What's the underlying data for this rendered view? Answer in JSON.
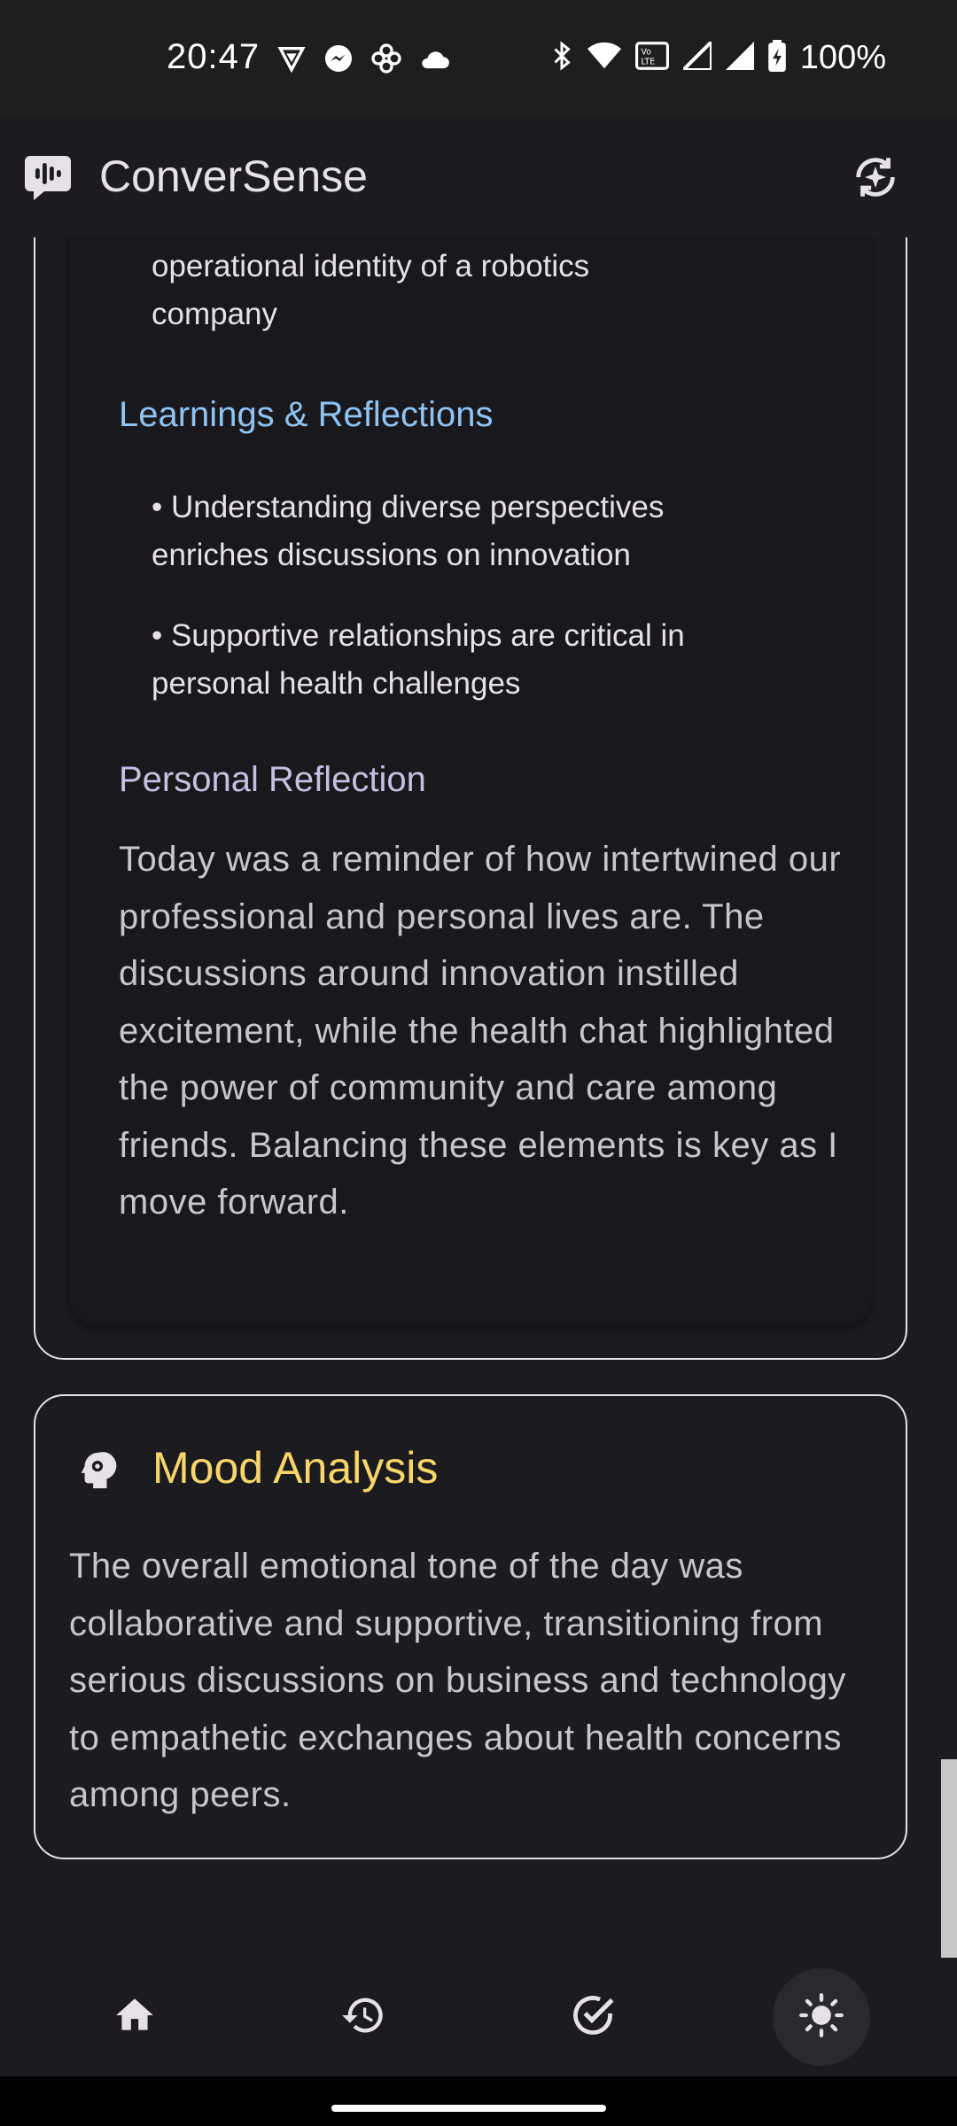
{
  "status_bar": {
    "time": "20:47",
    "left_icons": [
      "vpn-shield-icon",
      "messenger-icon",
      "pinwheel-icon",
      "cloud-icon"
    ],
    "right_icons": [
      "bluetooth-icon",
      "wifi-icon",
      "volte-icon",
      "signal-icon",
      "signal-icon",
      "battery-charging-icon"
    ],
    "battery": "100%"
  },
  "app_bar": {
    "title": "ConverSense",
    "logo_icon": "waveform-chat-icon",
    "action_icon": "ai-sparkle-sync-icon"
  },
  "summary_card": {
    "partial_bullet_lines": [
      "operational identity of a robotics",
      "company"
    ],
    "learnings_heading": "Learnings & Reflections",
    "learnings": [
      {
        "line1": "• Understanding diverse perspectives",
        "line2": "enriches discussions on innovation"
      },
      {
        "line1": "• Supportive relationships are critical in",
        "line2": "personal health challenges"
      }
    ],
    "reflection_heading": "Personal Reflection",
    "reflection_text": "Today was a reminder of how intertwined our professional and personal lives are. The discussions around innovation instilled excitement, while the health chat highlighted the power of community and care among friends. Balancing these elements is key as I move forward."
  },
  "mood_card": {
    "icon": "head-gear-icon",
    "title": "Mood Analysis",
    "text": "The overall emotional tone of the day was collaborative and supportive, transitioning from serious discussions on business and technology to empathetic exchanges about health concerns among peers."
  },
  "bottom_nav": {
    "items": [
      {
        "icon": "home-icon",
        "active": false
      },
      {
        "icon": "history-icon",
        "active": false
      },
      {
        "icon": "check-circle-icon",
        "active": false
      },
      {
        "icon": "sun-icon",
        "active": true
      }
    ]
  },
  "colors": {
    "background": "#1c1b20",
    "heading_blue": "#8fc3f2",
    "heading_lavender": "#c8bfe0",
    "mood_yellow": "#f8d66b"
  }
}
